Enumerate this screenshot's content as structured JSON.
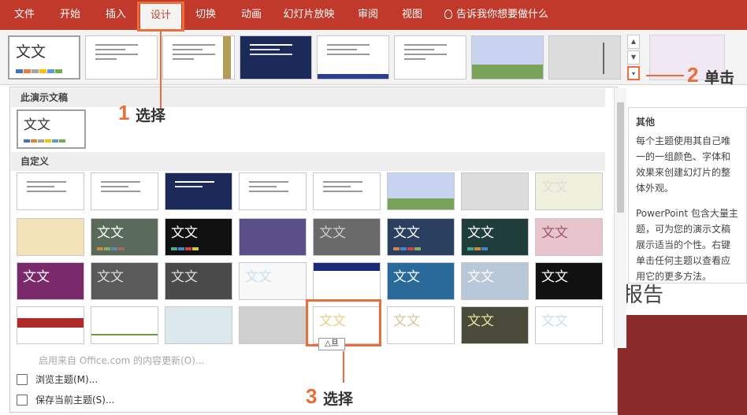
{
  "tabs": [
    {
      "label": "文件"
    },
    {
      "label": "开始"
    },
    {
      "label": "插入"
    },
    {
      "label": "设计"
    },
    {
      "label": "切换"
    },
    {
      "label": "动画"
    },
    {
      "label": "幻灯片放映"
    },
    {
      "label": "审阅"
    },
    {
      "label": "视图"
    }
  ],
  "tell_me": "告诉我你想要做什么",
  "theme_sample_text": "文文",
  "gallery": {
    "section_this": "此演示文稿",
    "section_custom": "自定义",
    "menu": {
      "enable_updates": "启用来自 Office.com 的内容更新(O)...",
      "browse": "浏览主题(M)...",
      "save": "保存当前主题(S)..."
    },
    "hover_tip": "△旦"
  },
  "tooltip": {
    "title": "其他",
    "p1": "每个主题使用其自己唯一的一组颜色、字体和效果来创建幻灯片的整体外观。",
    "p2": "PowerPoint 包含大量主题，可为您的演示文稿展示适当的个性。右键单击任何主题以查看应用它的更多方法。"
  },
  "slide_text": "报告",
  "callouts": {
    "step1_num": "1",
    "step1_text": "选择",
    "step2_num": "2",
    "step2_text": "单击",
    "step3_num": "3",
    "step3_text": "选择"
  },
  "colors": {
    "accent": "#c0392b",
    "callout": "#e96e3a"
  }
}
